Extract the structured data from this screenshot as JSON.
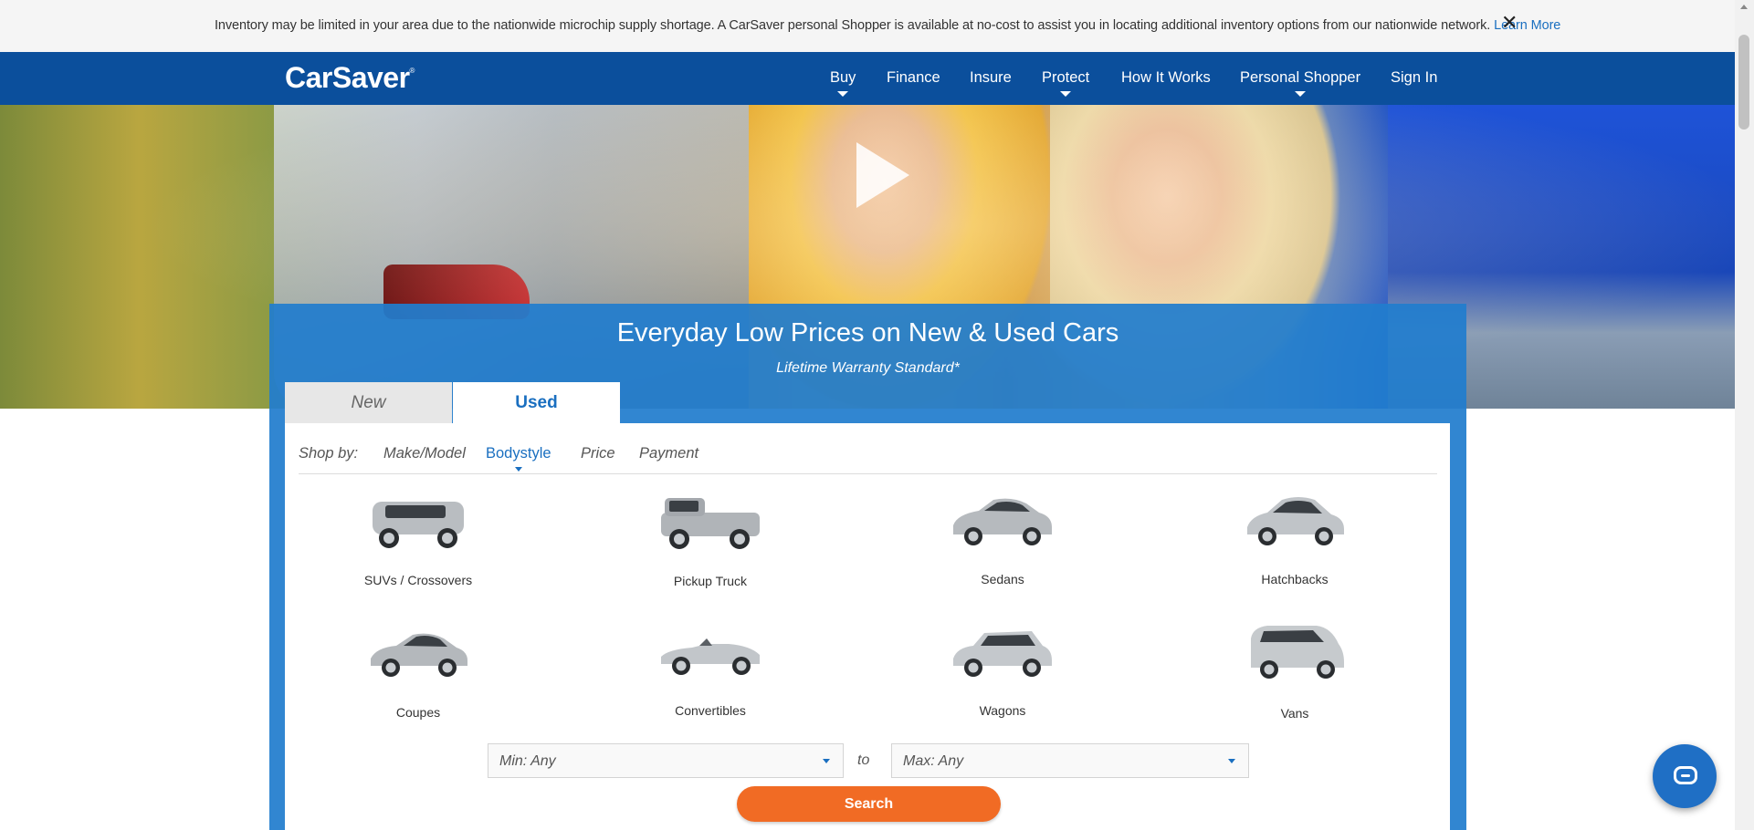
{
  "notice": {
    "text": "Inventory may be limited in your area due to the nationwide microchip supply shortage. A CarSaver personal Shopper is available at no-cost to assist you in locating additional inventory options from our nationwide network. ",
    "link": "Learn More",
    "close": "✕"
  },
  "nav": {
    "logo": "CarSaver",
    "logo_mark": "®",
    "items": [
      {
        "label": "Buy",
        "has_caret": true
      },
      {
        "label": "Finance",
        "has_caret": false
      },
      {
        "label": "Insure",
        "has_caret": false
      },
      {
        "label": "Protect",
        "has_caret": true
      },
      {
        "label": "How It Works",
        "has_caret": false
      },
      {
        "label": "Personal Shopper",
        "has_caret": true
      },
      {
        "label": "Sign In",
        "has_caret": false
      }
    ]
  },
  "hero": {
    "headline": "Everyday Low Prices on New & Used Cars",
    "subhead": "Lifetime Warranty Standard*"
  },
  "tabs": {
    "new": "New",
    "used": "Used",
    "active": "Used"
  },
  "shopby": {
    "label": "Shop by:",
    "options": [
      "Make/Model",
      "Bodystyle",
      "Price",
      "Payment"
    ],
    "active": "Bodystyle"
  },
  "bodystyles": [
    {
      "label": "SUVs / Crossovers"
    },
    {
      "label": "Pickup Truck"
    },
    {
      "label": "Sedans"
    },
    {
      "label": "Hatchbacks"
    },
    {
      "label": "Coupes"
    },
    {
      "label": "Convertibles"
    },
    {
      "label": "Wagons"
    },
    {
      "label": "Vans"
    }
  ],
  "range": {
    "min": "Min: Any",
    "to": "to",
    "max": "Max: Any"
  },
  "search": {
    "label": "Search"
  },
  "colors": {
    "nav_bg": "#0b4f9c",
    "panel_bg": "#217dcd",
    "accent": "#1a6fc0",
    "search_btn": "#f16b24"
  },
  "icons": [
    "close-icon",
    "play-icon",
    "chat-icon",
    "chevron-down-icon"
  ]
}
